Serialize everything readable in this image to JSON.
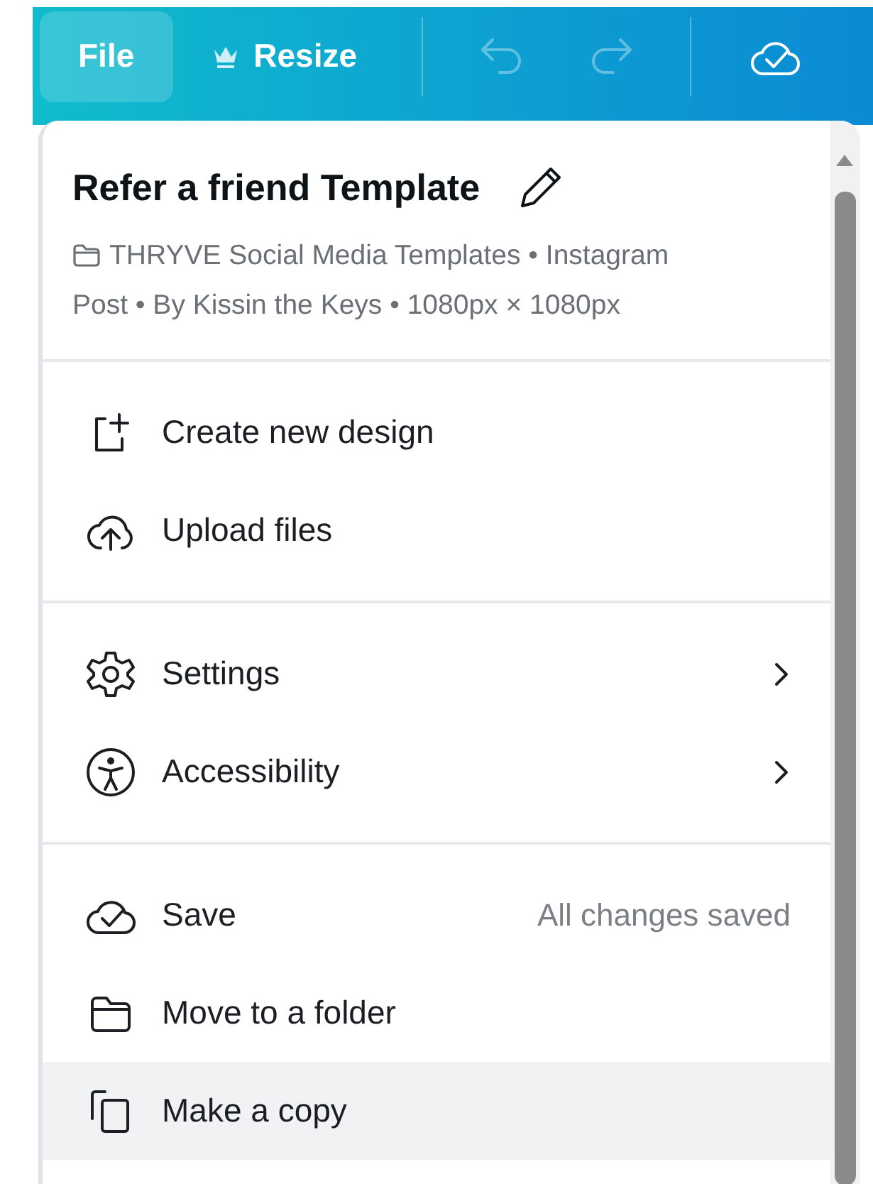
{
  "toolbar": {
    "tabs": [
      {
        "label": "File",
        "selected": true
      },
      {
        "label": "Resize",
        "selected": false
      }
    ],
    "undo": {
      "disabled": true
    },
    "redo": {
      "disabled": true
    }
  },
  "menu": {
    "title": "Refer a friend Template",
    "meta": "THRYVE Social Media Templates • Instagram Post • By Kissin the Keys • 1080px × 1080px",
    "sections": [
      {
        "items": [
          {
            "label": "Create new design",
            "submenu": false,
            "highlighted": false
          },
          {
            "label": "Upload files",
            "submenu": false,
            "highlighted": false
          }
        ]
      },
      {
        "items": [
          {
            "label": "Settings",
            "submenu": true,
            "highlighted": false
          },
          {
            "label": "Accessibility",
            "submenu": true,
            "highlighted": false
          }
        ]
      },
      {
        "items": [
          {
            "label": "Save",
            "status": "All changes saved",
            "submenu": false,
            "highlighted": false
          },
          {
            "label": "Move to a folder",
            "submenu": false,
            "highlighted": false
          },
          {
            "label": "Make a copy",
            "submenu": false,
            "highlighted": true
          }
        ]
      }
    ]
  }
}
